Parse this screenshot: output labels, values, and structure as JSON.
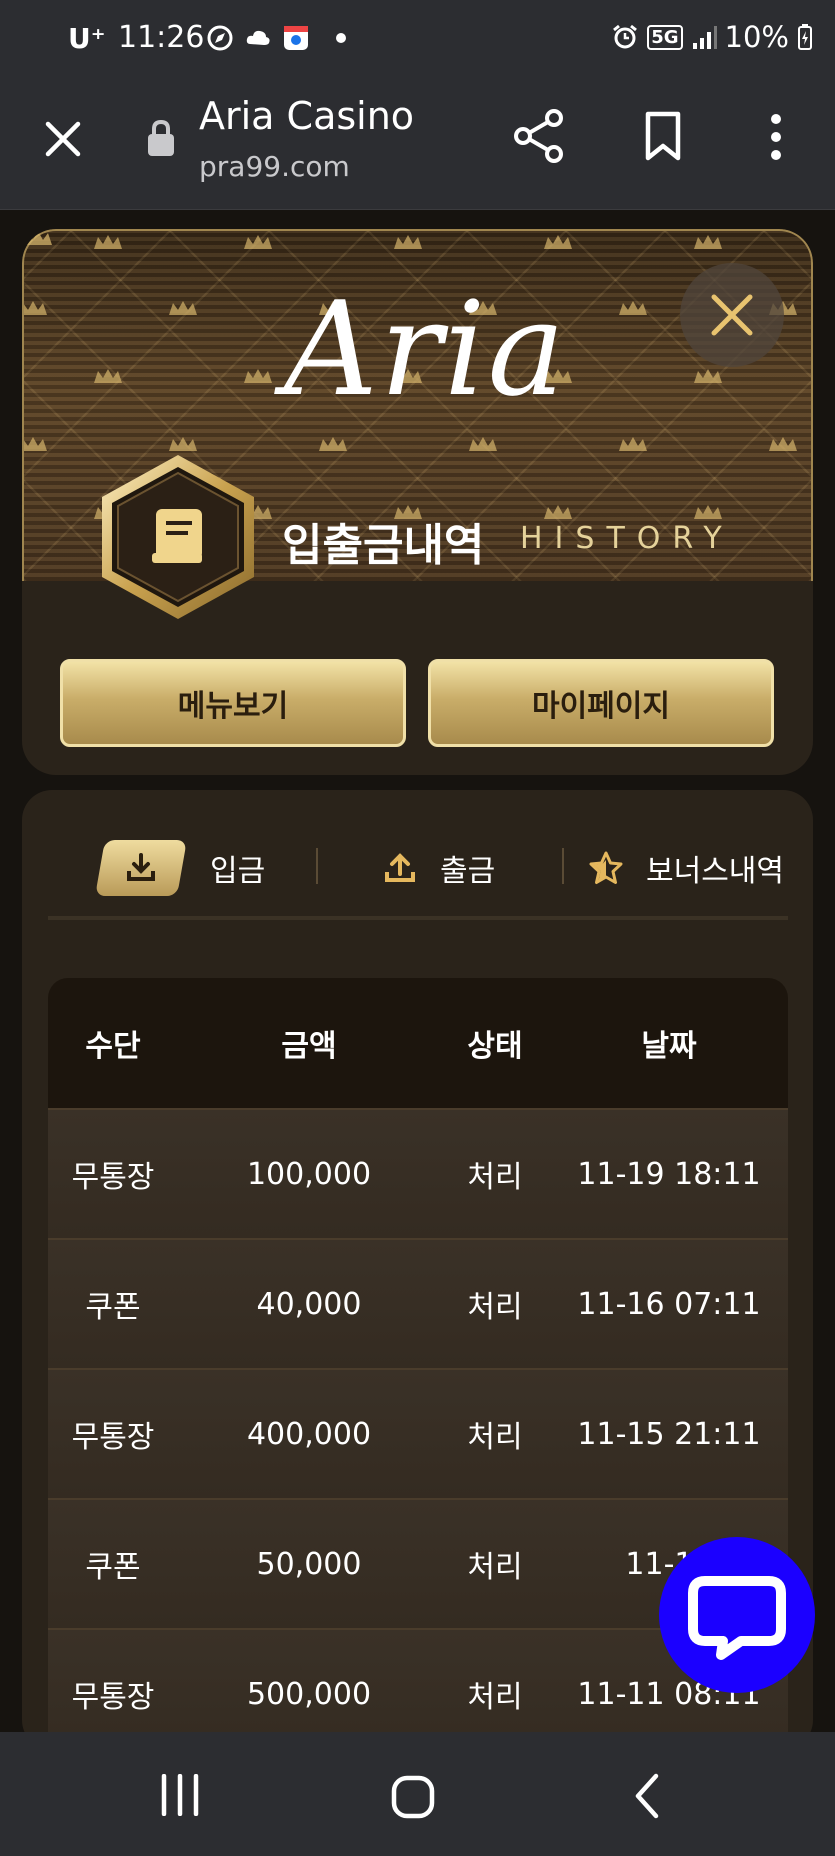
{
  "status_bar": {
    "carrier": "U⁺",
    "time": "11:26",
    "network": "5G",
    "battery": "10%"
  },
  "browser": {
    "title": "Aria Casino",
    "url": "pra99.com"
  },
  "hero": {
    "logo": "Aria",
    "title": "입출금내역",
    "subtitle": "HISTORY",
    "menu_button": "메뉴보기",
    "mypage_button": "마이페이지"
  },
  "tabs": {
    "deposit": "입금",
    "withdraw": "출금",
    "bonus": "보너스내역"
  },
  "table": {
    "headers": [
      "수단",
      "금액",
      "상태",
      "날짜"
    ],
    "rows": [
      [
        "무통장",
        "100,000",
        "처리",
        "11-19 18:11"
      ],
      [
        "쿠폰",
        "40,000",
        "처리",
        "11-16 07:11"
      ],
      [
        "무통장",
        "400,000",
        "처리",
        "11-15 21:11"
      ],
      [
        "쿠폰",
        "50,000",
        "처리",
        "11-12 "
      ],
      [
        "무통장",
        "500,000",
        "처리",
        "11-11 08:11"
      ]
    ]
  },
  "colors": {
    "gold": "#c9ad69",
    "chat": "#1b00ff",
    "card": "#2a231a"
  }
}
